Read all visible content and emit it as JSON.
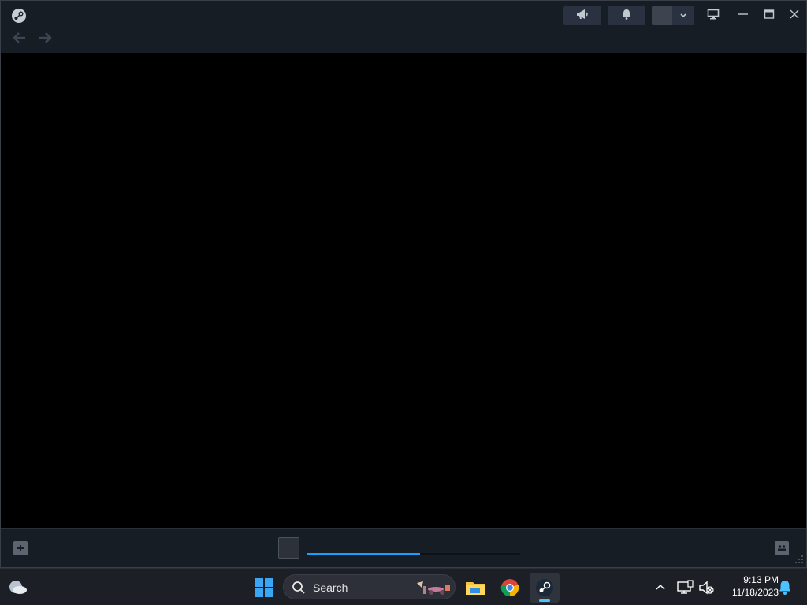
{
  "window": {
    "app": "steam",
    "icons": [
      "steam-logo-icon",
      "back-arrow-icon",
      "forward-arrow-icon",
      "megaphone-icon",
      "bell-icon",
      "chevron-down-icon",
      "big-picture-icon",
      "minimize-icon",
      "maximize-icon",
      "close-icon"
    ]
  },
  "bottombar": {
    "icons": [
      "add-game-icon",
      "friends-chat-icon",
      "resize-grip-icon"
    ],
    "download_progress": 0.53
  },
  "taskbar": {
    "search_label": "Search",
    "clock_time": "9:13 PM",
    "clock_date": "11/18/2023",
    "icons": [
      "weather-icon",
      "windows-start-icon",
      "search-icon",
      "file-explorer-icon",
      "chrome-icon",
      "steam-icon",
      "show-hidden-icons-chevron",
      "network-icon",
      "volume-muted-icon",
      "notification-bell-icon"
    ]
  },
  "colors": {
    "titlebar": "#171d25",
    "accent": "#1a9fff",
    "taskbar": "#1c1f26"
  }
}
